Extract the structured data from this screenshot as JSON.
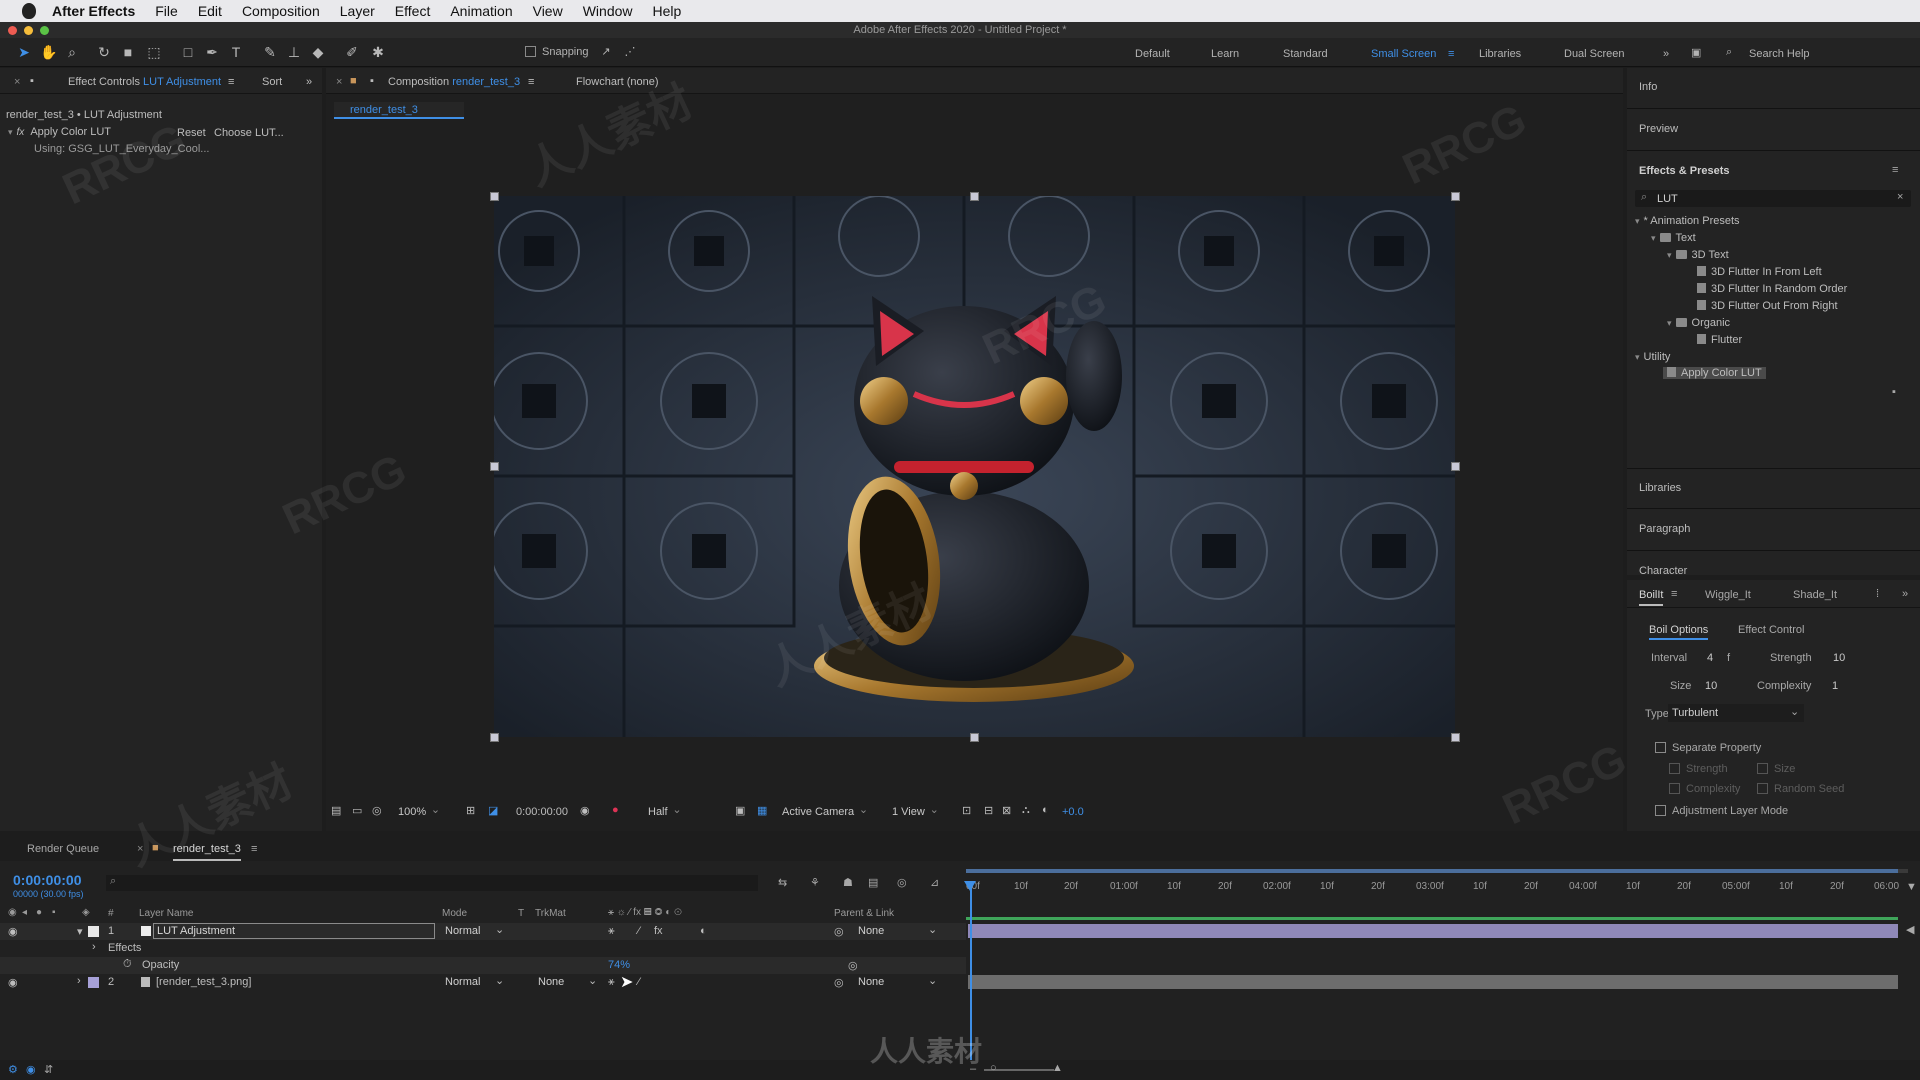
{
  "menubar": {
    "app_name": "After Effects",
    "items": [
      "File",
      "Edit",
      "Composition",
      "Layer",
      "Effect",
      "Animation",
      "View",
      "Window",
      "Help"
    ]
  },
  "window": {
    "title": "Adobe After Effects 2020 - Untitled Project *"
  },
  "toolbar": {
    "snapping_label": "Snapping",
    "workspaces": [
      "Default",
      "Learn",
      "Standard",
      "Small Screen",
      "Libraries",
      "Dual Screen"
    ],
    "active_workspace": "Small Screen",
    "search_placeholder": "Search Help"
  },
  "effect_controls": {
    "tab_prefix": "Effect Controls",
    "tab_layer": "LUT Adjustment",
    "sort_label": "Sort",
    "breadcrumb": "render_test_3 • LUT Adjustment",
    "effect_name": "Apply Color LUT",
    "reset_label": "Reset",
    "choose_label": "Choose LUT...",
    "using_text": "Using: GSG_LUT_Everyday_Cool..."
  },
  "composition": {
    "tab_prefix": "Composition",
    "tab_name": "render_test_3",
    "flowchart_label": "Flowchart (none)",
    "subtab": "render_test_3",
    "zoom": "100%",
    "timecode": "0:00:00:00",
    "resolution": "Half",
    "camera": "Active Camera",
    "views": "1 View",
    "exposure": "+0.0"
  },
  "right_panel": {
    "sections": [
      "Info",
      "Preview",
      "Effects & Presets"
    ],
    "search_value": "LUT",
    "tree": {
      "animation_presets": "* Animation Presets",
      "text": "Text",
      "text_3d": "3D Text",
      "presets_3d": [
        "3D Flutter In From Left",
        "3D Flutter In Random Order",
        "3D Flutter Out From Right"
      ],
      "organic": "Organic",
      "flutter": "Flutter",
      "utility": "Utility",
      "apply_color_lut": "Apply Color LUT"
    },
    "lower_sections": [
      "Libraries",
      "Paragraph",
      "Character"
    ]
  },
  "boilit": {
    "tabs": [
      "BoilIt",
      "Wiggle_It",
      "Shade_It"
    ],
    "subtabs": [
      "Boil Options",
      "Effect Control"
    ],
    "interval_label": "Interval",
    "interval_value": "4",
    "interval_unit": "f",
    "strength_label": "Strength",
    "strength_value": "10",
    "size_label": "Size",
    "size_value": "10",
    "complexity_label": "Complexity",
    "complexity_value": "1",
    "type_label": "Type",
    "type_value": "Turbulent",
    "separate_property": "Separate Property",
    "sep_strength": "Strength",
    "sep_size": "Size",
    "sep_complexity": "Complexity",
    "sep_random_seed": "Random Seed",
    "adjustment_layer_mode": "Adjustment Layer Mode"
  },
  "timeline": {
    "render_queue_tab": "Render Queue",
    "comp_tab": "render_test_3",
    "timecode": "0:00:00:00",
    "frame_info": "00000 (30.00 fps)",
    "columns": {
      "layer_name": "Layer Name",
      "mode": "Mode",
      "t": "T",
      "trkmat": "TrkMat",
      "parent": "Parent & Link",
      "num": "#"
    },
    "layers": [
      {
        "num": "1",
        "name": "LUT Adjustment",
        "mode": "Normal",
        "trkmat": "",
        "parent": "None",
        "color": "#e8e8e8"
      },
      {
        "num": "2",
        "name": "[render_test_3.png]",
        "mode": "Normal",
        "trkmat": "None",
        "parent": "None",
        "color": "#a7a1d8"
      }
    ],
    "effects_label": "Effects",
    "opacity_label": "Opacity",
    "opacity_value": "74%",
    "ruler": [
      "00f",
      "10f",
      "20f",
      "01:00f",
      "10f",
      "20f",
      "02:00f",
      "10f",
      "20f",
      "03:00f",
      "10f",
      "20f",
      "04:00f",
      "10f",
      "20f",
      "05:00f",
      "10f",
      "20f",
      "06:00"
    ]
  },
  "colors": {
    "accent": "#3f8fe6",
    "panel_bg": "#232323",
    "app_bg": "#1d1d1d",
    "layer1_bar": "#8f88b8",
    "layer2_bar": "#707070"
  },
  "watermark": {
    "text_a": "RRCG",
    "text_b": "人人素材"
  }
}
